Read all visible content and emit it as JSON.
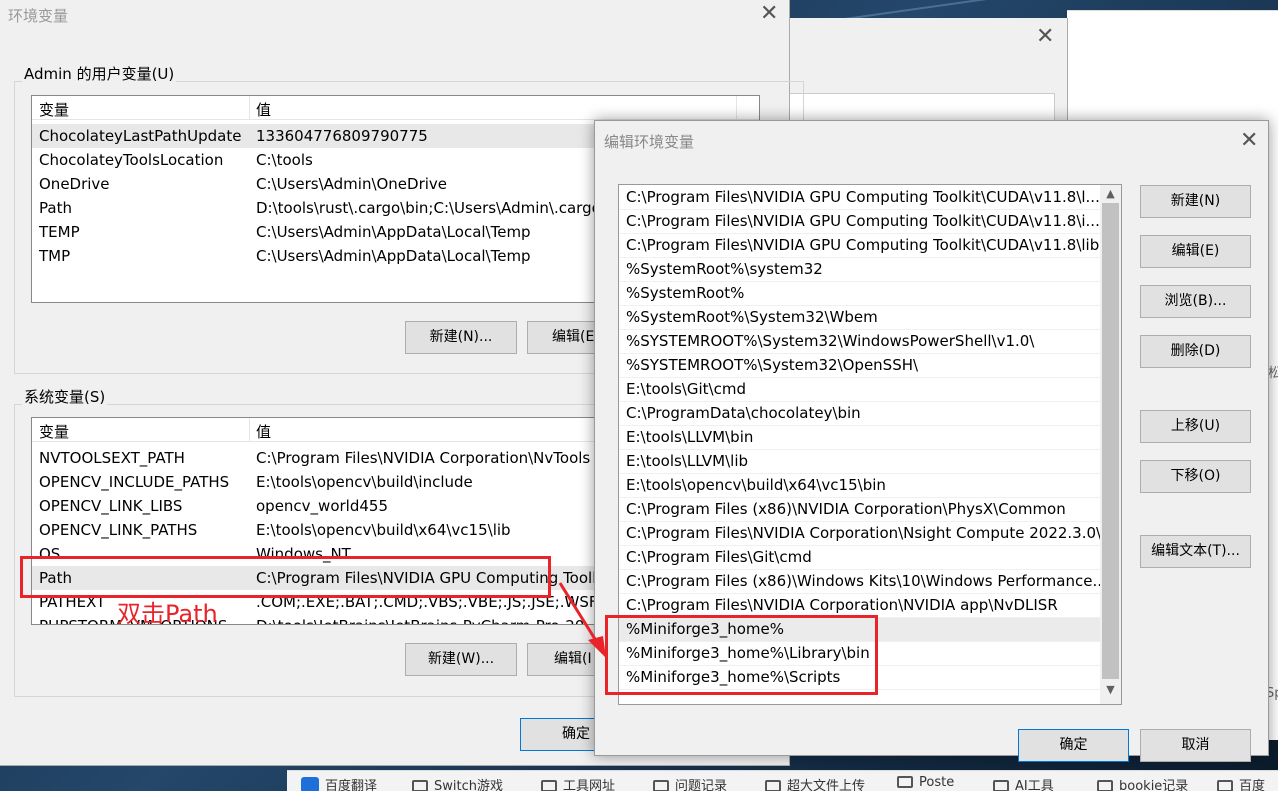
{
  "main_window": {
    "title": "环境变量",
    "user_group_label": "Admin 的用户变量(U)",
    "user_headers": [
      "变量",
      "值"
    ],
    "user_vars": [
      {
        "name": "ChocolateyLastPathUpdate",
        "value": "133604776809790775"
      },
      {
        "name": "ChocolateyToolsLocation",
        "value": "C:\\tools"
      },
      {
        "name": "OneDrive",
        "value": "C:\\Users\\Admin\\OneDrive"
      },
      {
        "name": "Path",
        "value": "D:\\tools\\rust\\.cargo\\bin;C:\\Users\\Admin\\.cargo"
      },
      {
        "name": "TEMP",
        "value": "C:\\Users\\Admin\\AppData\\Local\\Temp"
      },
      {
        "name": "TMP",
        "value": "C:\\Users\\Admin\\AppData\\Local\\Temp"
      }
    ],
    "user_buttons": {
      "new": "新建(N)...",
      "edit": "编辑(E"
    },
    "system_group_label": "系统变量(S)",
    "system_headers": [
      "变量",
      "值"
    ],
    "system_vars": [
      {
        "name": "NVTOOLSEXT_PATH",
        "value": "C:\\Program Files\\NVIDIA Corporation\\NvTools"
      },
      {
        "name": "OPENCV_INCLUDE_PATHS",
        "value": "E:\\tools\\opencv\\build\\include"
      },
      {
        "name": "OPENCV_LINK_LIBS",
        "value": "opencv_world455"
      },
      {
        "name": "OPENCV_LINK_PATHS",
        "value": "E:\\tools\\opencv\\build\\x64\\vc15\\lib"
      },
      {
        "name": "OS",
        "value": "Windows_NT"
      },
      {
        "name": "Path",
        "value": "C:\\Program Files\\NVIDIA GPU Computing Tooll"
      },
      {
        "name": "PATHEXT",
        "value": ".COM;.EXE;.BAT;.CMD;.VBS;.VBE;.JS;.JSE;.WSF;.W"
      },
      {
        "name": "PHPSTORM_VM_OPTIONS",
        "value": "D:\\tools\\JetBrains\\JetBrains-PyCharm-Pro-20"
      }
    ],
    "system_buttons": {
      "new": "新建(W)...",
      "edit": "编辑(I"
    },
    "ok": "确定"
  },
  "edit_dialog": {
    "title": "编辑环境变量",
    "entries": [
      "C:\\Program Files\\NVIDIA GPU Computing Toolkit\\CUDA\\v11.8\\l...",
      "C:\\Program Files\\NVIDIA GPU Computing Toolkit\\CUDA\\v11.8\\i...",
      "C:\\Program Files\\NVIDIA GPU Computing Toolkit\\CUDA\\v11.8\\lib",
      "%SystemRoot%\\system32",
      "%SystemRoot%",
      "%SystemRoot%\\System32\\Wbem",
      "%SYSTEMROOT%\\System32\\WindowsPowerShell\\v1.0\\",
      "%SYSTEMROOT%\\System32\\OpenSSH\\",
      "E:\\tools\\Git\\cmd",
      "C:\\ProgramData\\chocolatey\\bin",
      "E:\\tools\\LLVM\\bin",
      "E:\\tools\\LLVM\\lib",
      "E:\\tools\\opencv\\build\\x64\\vc15\\bin",
      "C:\\Program Files (x86)\\NVIDIA Corporation\\PhysX\\Common",
      "C:\\Program Files\\NVIDIA Corporation\\Nsight Compute 2022.3.0\\",
      "C:\\Program Files\\Git\\cmd",
      "C:\\Program Files (x86)\\Windows Kits\\10\\Windows Performance...",
      "C:\\Program Files\\NVIDIA Corporation\\NVIDIA app\\NvDLISR",
      "%Miniforge3_home%",
      "%Miniforge3_home%\\Library\\bin",
      "%Miniforge3_home%\\Scripts"
    ],
    "buttons": {
      "new": "新建(N)",
      "edit": "编辑(E)",
      "browse": "浏览(B)...",
      "delete": "删除(D)",
      "move_up": "上移(U)",
      "move_down": "下移(O)",
      "edit_text": "编辑文本(T)...",
      "ok": "确定",
      "cancel": "取消"
    }
  },
  "annotation": {
    "text": "双击Path",
    "color": "#e8242a"
  },
  "taskbar": {
    "items": [
      "百度翻译",
      "Switch游戏",
      "工具网址",
      "问题记录",
      "超大文件上传",
      "Poste",
      "AI工具",
      "bookie记录",
      "百度"
    ]
  },
  "edge_chars": [
    "松",
    "Sp"
  ]
}
